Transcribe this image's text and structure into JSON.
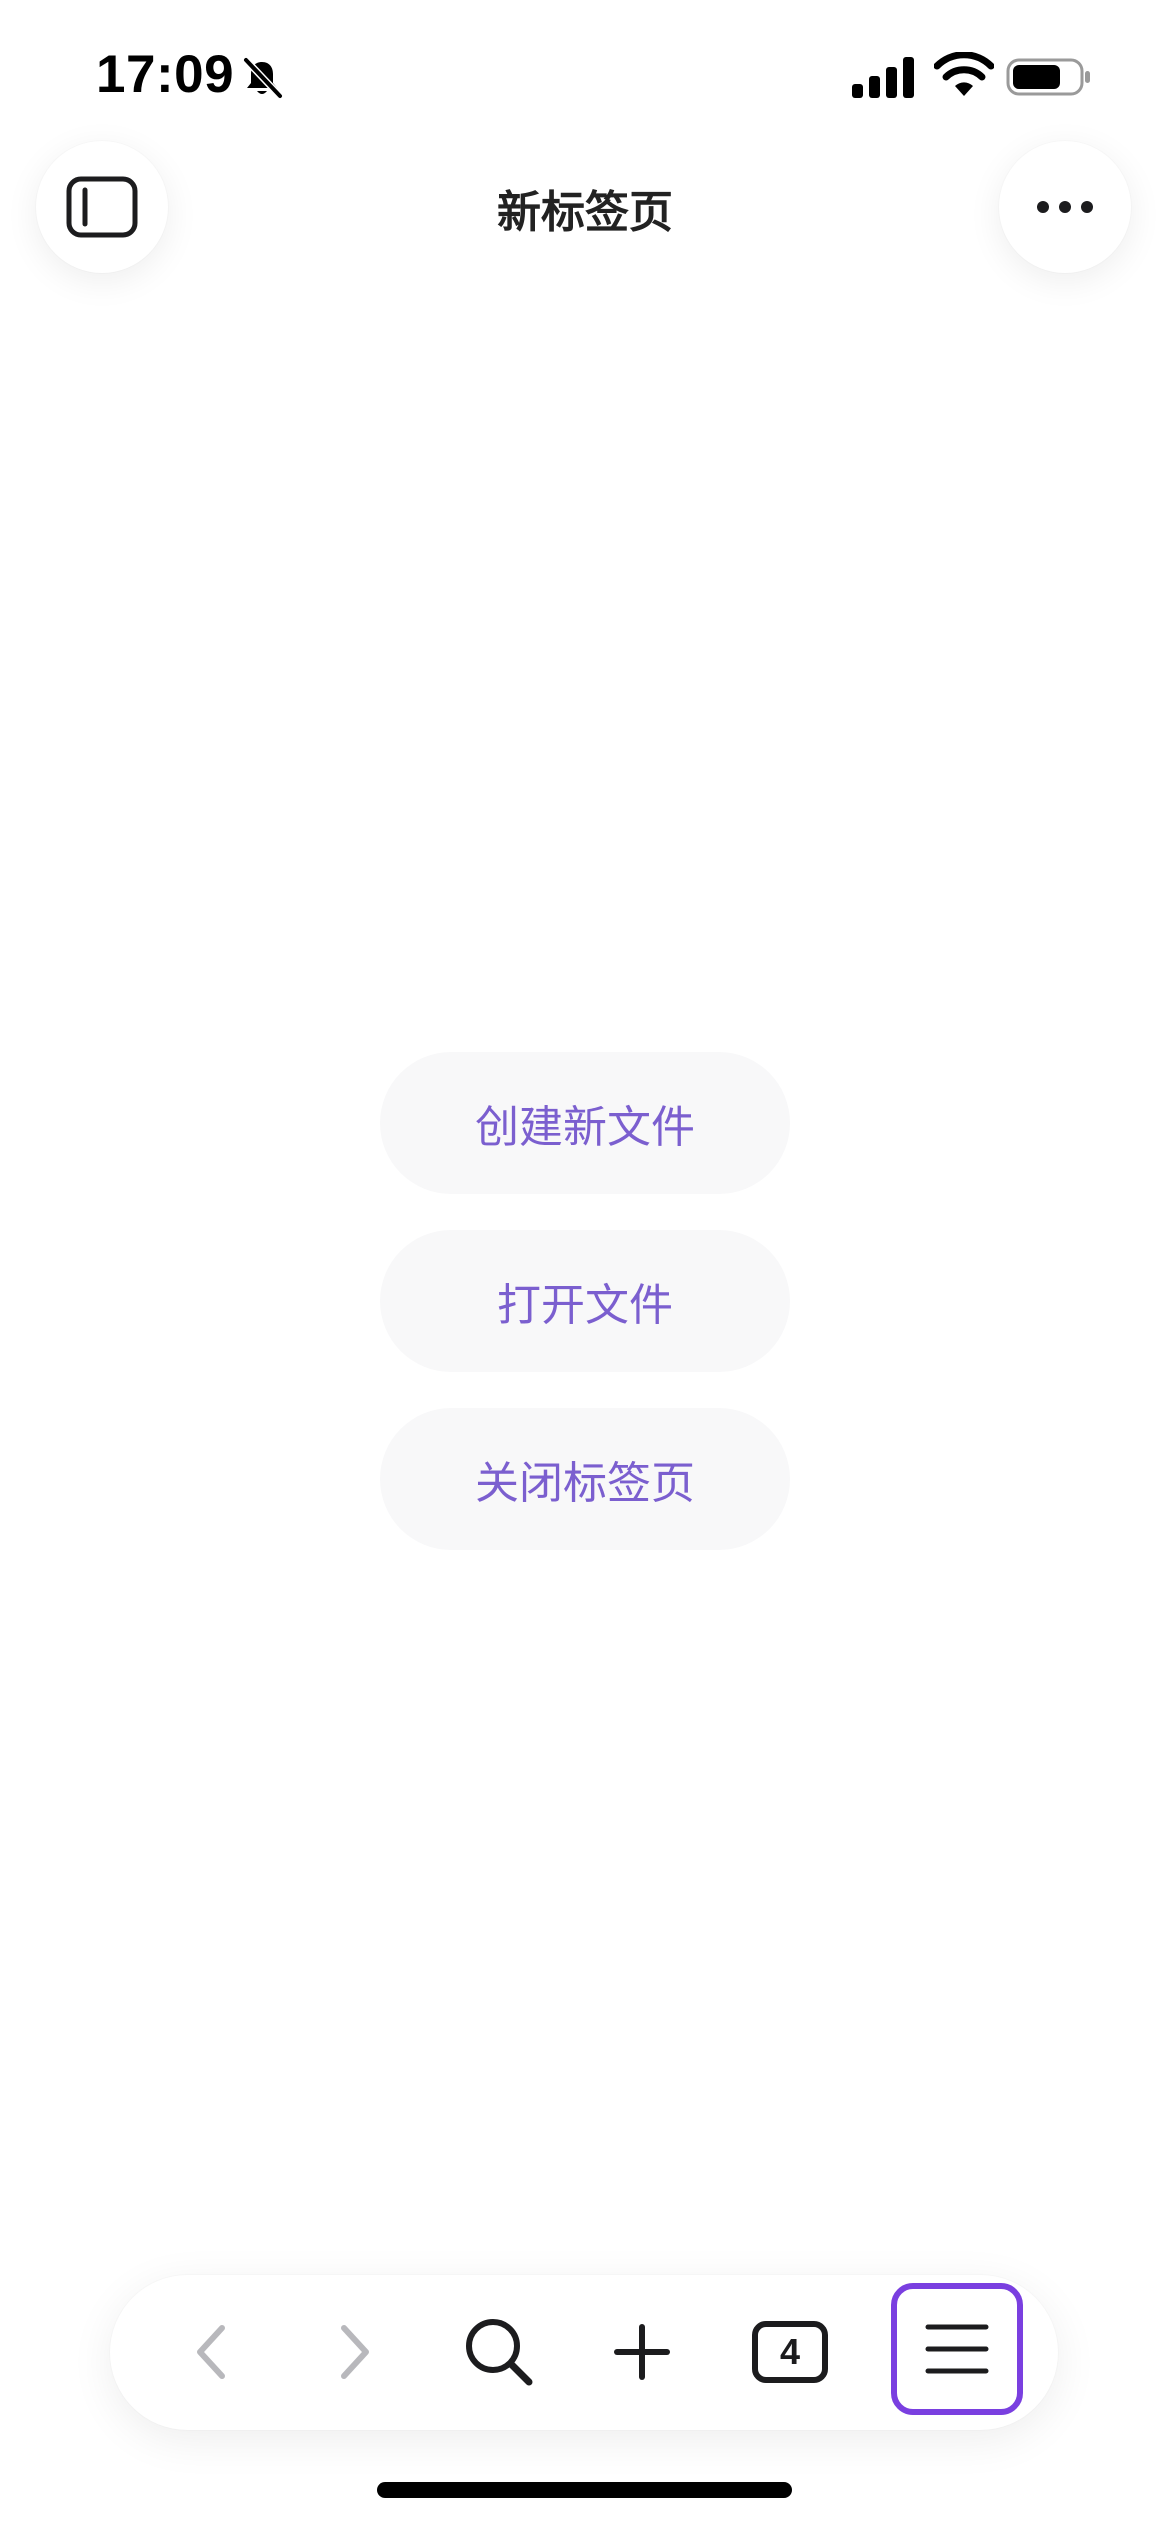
{
  "status_bar": {
    "time": "17:09",
    "icons": [
      "bell-slash-icon",
      "cellular-signal-icon",
      "wifi-icon",
      "battery-icon"
    ]
  },
  "header": {
    "title": "新标签页",
    "left_button_icon": "sidebar-toggle-icon",
    "right_button_icon": "more-horizontal-icon"
  },
  "actions": [
    {
      "label": "创建新文件"
    },
    {
      "label": "打开文件"
    },
    {
      "label": "关闭标签页"
    }
  ],
  "toolbar": {
    "items": [
      "back-icon",
      "forward-icon",
      "search-icon",
      "new-tab-icon",
      "tab-switcher-icon",
      "menu-icon"
    ],
    "tab_count": "4"
  },
  "colors": {
    "accent": "#7b5fcf",
    "menu_highlight": "#7a3fe0",
    "pill_bg": "#f8f8f9",
    "disabled_icon": "#b8b8bc"
  }
}
